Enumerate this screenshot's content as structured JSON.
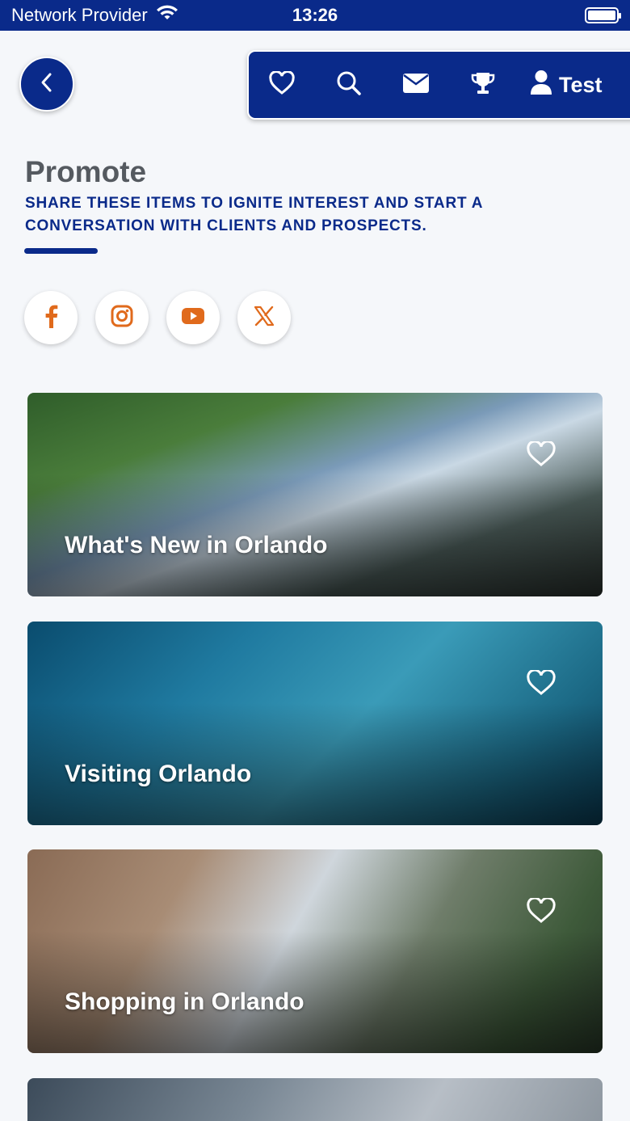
{
  "status_bar": {
    "carrier": "Network Provider",
    "time": "13:26"
  },
  "toolbar": {
    "user_label": "Test"
  },
  "header": {
    "title": "Promote",
    "subtitle": "SHARE THESE ITEMS TO IGNITE INTEREST AND START A CONVERSATION WITH CLIENTS AND PROSPECTS."
  },
  "social": [
    "facebook",
    "instagram",
    "youtube",
    "x"
  ],
  "cards": [
    {
      "title": "What's New in Orlando"
    },
    {
      "title": "Visiting Orlando"
    },
    {
      "title": "Shopping in Orlando"
    },
    {
      "title": ""
    }
  ],
  "colors": {
    "brand_blue": "#0a2a8a",
    "social_orange": "#e06a1c",
    "title_gray": "#555a60"
  }
}
